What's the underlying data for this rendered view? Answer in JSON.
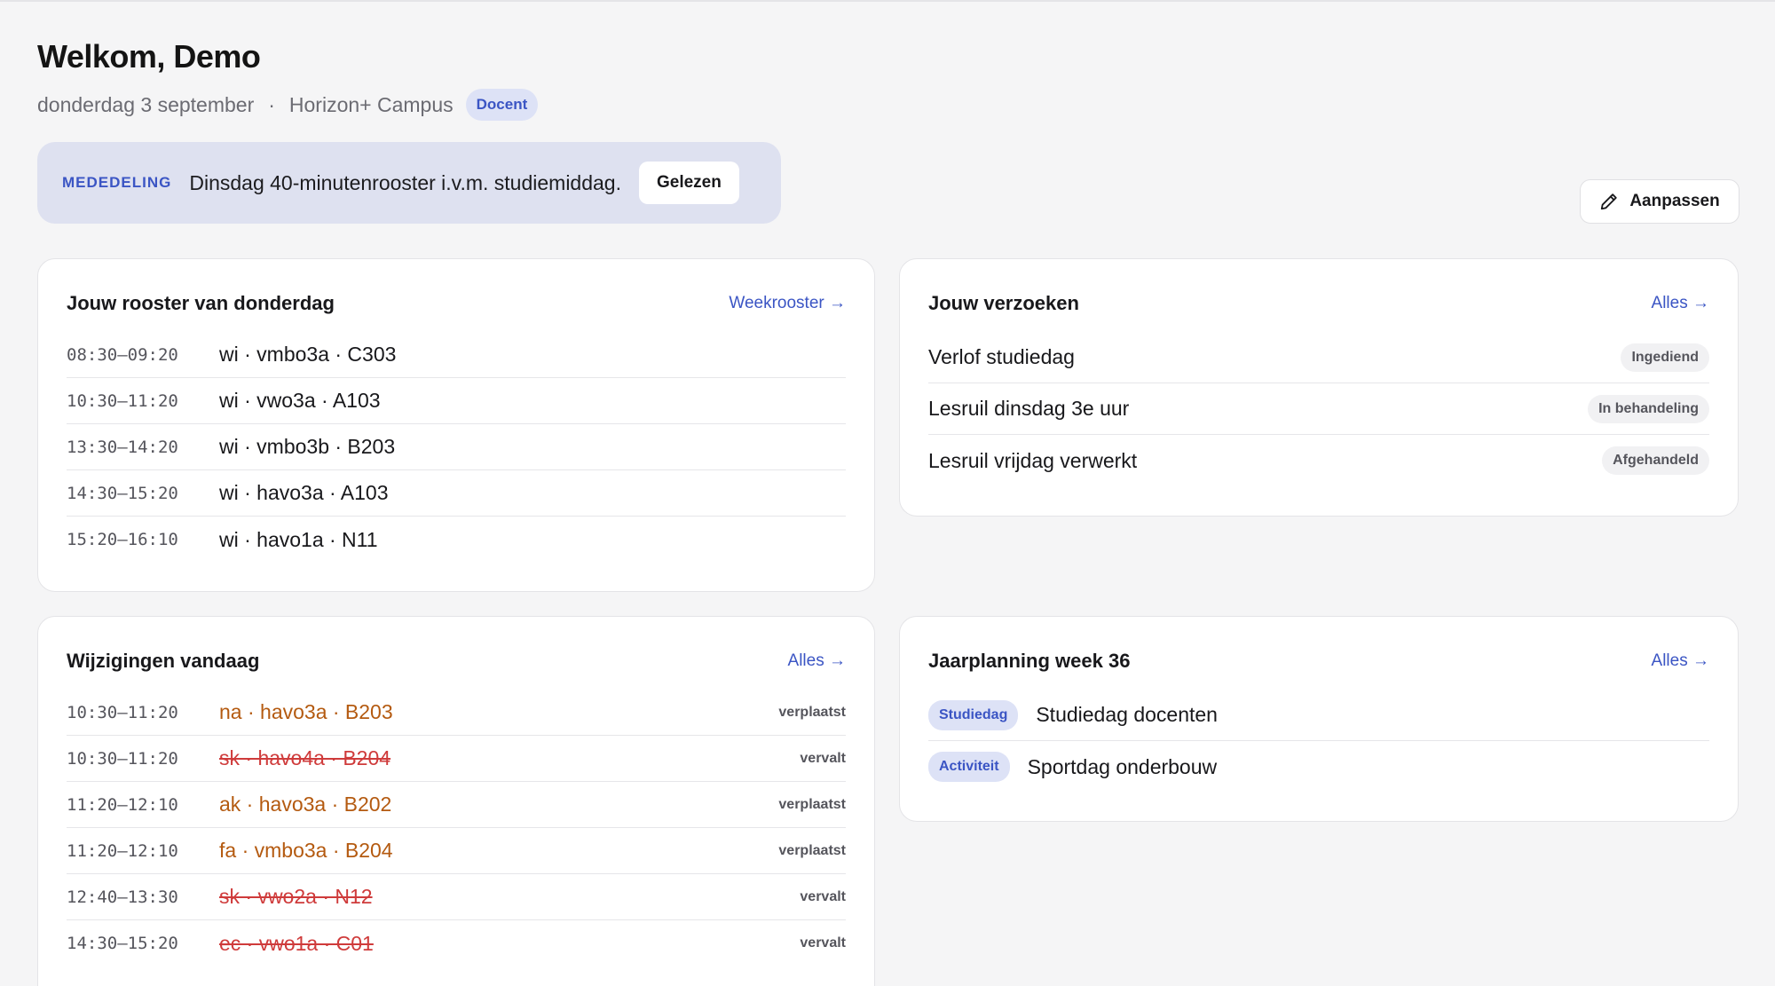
{
  "header": {
    "title": "Welkom, Demo",
    "date": "donderdag 3 september",
    "separator": "·",
    "campus": "Horizon+ Campus",
    "role": "Docent"
  },
  "announcement": {
    "label": "MEDEDELING",
    "text": "Dinsdag 40-minutenrooster i.v.m. studiemiddag.",
    "button": "Gelezen"
  },
  "toolbar": {
    "edit_label": "Aanpassen",
    "edit_icon": "pencil-icon"
  },
  "schedule": {
    "title": "Jouw rooster van donderdag",
    "link": "Weekrooster →",
    "rows": [
      {
        "time": "08:30–09:20",
        "lesson": "wi · vmbo3a · C303"
      },
      {
        "time": "10:30–11:20",
        "lesson": "wi · vwo3a · A103"
      },
      {
        "time": "13:30–14:20",
        "lesson": "wi · vmbo3b · B203"
      },
      {
        "time": "14:30–15:20",
        "lesson": "wi · havo3a · A103"
      },
      {
        "time": "15:20–16:10",
        "lesson": "wi · havo1a · N11"
      }
    ]
  },
  "requests": {
    "title": "Jouw verzoeken",
    "link": "Alles →",
    "rows": [
      {
        "title": "Verlof studiedag",
        "status": "Ingediend"
      },
      {
        "title": "Lesruil dinsdag 3e uur",
        "status": "In behandeling"
      },
      {
        "title": "Lesruil vrijdag verwerkt",
        "status": "Afgehandeld"
      }
    ]
  },
  "changes": {
    "title": "Wijzigingen vandaag",
    "link": "Alles →",
    "rows": [
      {
        "time": "10:30–11:20",
        "lesson": "na · havo3a · B203",
        "status": "verplaatst"
      },
      {
        "time": "10:30–11:20",
        "lesson": "sk · havo4a · B204",
        "status": "vervalt"
      },
      {
        "time": "11:20–12:10",
        "lesson": "ak · havo3a · B202",
        "status": "verplaatst"
      },
      {
        "time": "11:20–12:10",
        "lesson": "fa · vmbo3a · B204",
        "status": "verplaatst"
      },
      {
        "time": "12:40–13:30",
        "lesson": "sk · vwo2a · N12",
        "status": "vervalt"
      },
      {
        "time": "14:30–15:20",
        "lesson": "ec · vwo1a · C01",
        "status": "vervalt"
      }
    ]
  },
  "planning": {
    "title": "Jaarplanning week 36",
    "link": "Alles →",
    "rows": [
      {
        "tag": "Studiedag",
        "title": "Studiedag docenten"
      },
      {
        "tag": "Activiteit",
        "title": "Sportdag onderbouw"
      }
    ]
  },
  "colors": {
    "accent": "#3b55c4",
    "moved": "#b45a10",
    "cancelled": "#cf3b3b",
    "announcement_bg": "#dee1f0",
    "page_bg": "#f5f5f6"
  }
}
